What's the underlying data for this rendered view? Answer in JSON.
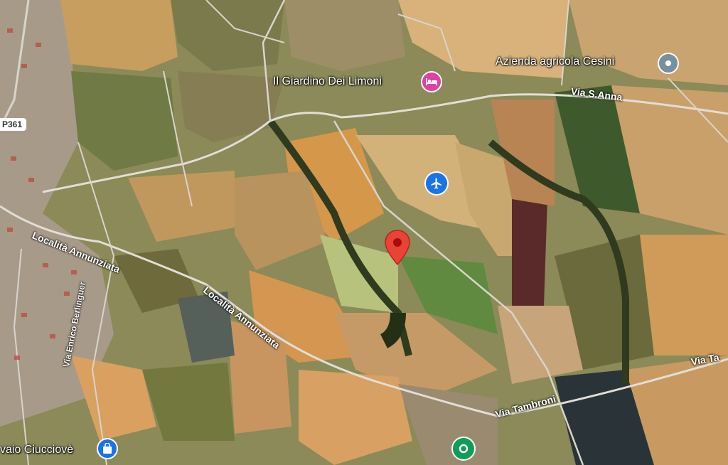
{
  "map": {
    "labels": {
      "azienda": "Azienda agricola Cesini",
      "giardino": "Il Giardino Dei Limoni",
      "vivaio": "vaio Ciucciovè"
    },
    "roads": {
      "via_sanna": "Via S.Anna",
      "localita_1": "Località Annunziata",
      "localita_2": "Località Annunziata",
      "berlinguer": "Via Enrico Berlinguer",
      "tambroni": "Via Tambroni",
      "tambroni_cut": "Via Ta"
    },
    "route_badge": "P361",
    "icons": {
      "hotel": "hotel-icon",
      "airport": "airplane-icon",
      "azienda": "place-icon",
      "shop": "shopping-bag-icon",
      "park": "park-icon",
      "selected": "location-pin-icon"
    },
    "colors": {
      "hotel_pin": "#e040a0",
      "airport_pin": "#1a73e8",
      "place_pin": "#78909c",
      "shop_pin": "#1a73e8",
      "park_pin": "#0f9d58",
      "selected_pin": "#ea4335"
    }
  }
}
